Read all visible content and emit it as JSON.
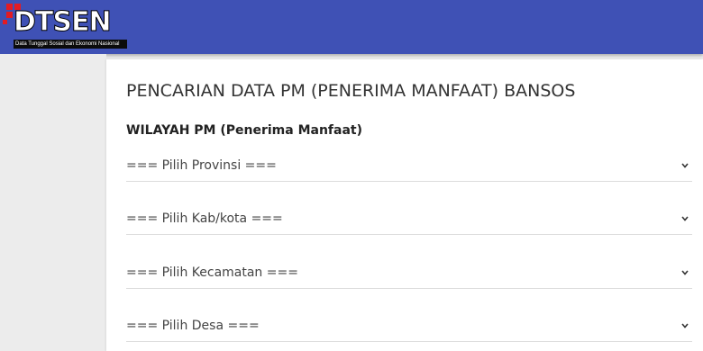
{
  "header": {
    "logo_text": "DTSEN",
    "logo_subtitle": "Data Tunggal Sosial dan Ekonomi Nasional",
    "background": "#3f51b5",
    "logo_accent": "#e31b23"
  },
  "main": {
    "title": "PENCARIAN DATA PM (PENERIMA MANFAAT) BANSOS",
    "section_label": "WILAYAH PM (Penerima Manfaat)",
    "selects": [
      {
        "value": "=== Pilih Provinsi ===",
        "icon": "chevron-down-icon"
      },
      {
        "value": "=== Pilih Kab/kota ===",
        "icon": "chevron-down-icon"
      },
      {
        "value": "=== Pilih Kecamatan ===",
        "icon": "chevron-down-icon"
      },
      {
        "value": "=== Pilih Desa ===",
        "icon": "chevron-down-icon"
      }
    ]
  }
}
